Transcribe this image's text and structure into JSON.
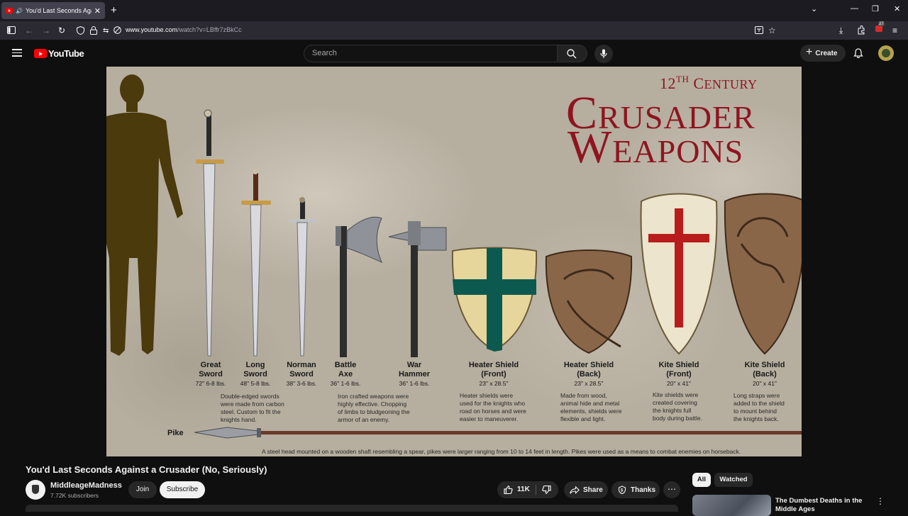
{
  "browser": {
    "tab_title": "You'd Last Seconds Against",
    "url_domain": "www.youtube.com",
    "url_path": "/watch?v=LBffr7zBkCc",
    "extension_badge": "27"
  },
  "youtube": {
    "logo_text": "YouTube",
    "search_placeholder": "Search",
    "create_label": "Create"
  },
  "video_frame": {
    "title_small": "12th Century",
    "title_line1": "Crusader",
    "title_line2": "Weapons",
    "weapons": [
      {
        "name1": "Great",
        "name2": "Sword",
        "dims": "72\" 6-8 lbs."
      },
      {
        "name1": "Long",
        "name2": "Sword",
        "dims": "48\" 5-8 lbs."
      },
      {
        "name1": "Norman",
        "name2": "Sword",
        "dims": "38\" 3-6 lbs."
      },
      {
        "name1": "Battle",
        "name2": "Axe",
        "dims": "36\" 1-6 lbs."
      },
      {
        "name1": "War",
        "name2": "Hammer",
        "dims": "36\" 1-6 lbs."
      },
      {
        "name1": "Heater Shield",
        "name2": "(Front)",
        "dims": "23\" x 28.5\""
      },
      {
        "name1": "Heater Shield",
        "name2": "(Back)",
        "dims": "23\" x 28.5\""
      },
      {
        "name1": "Kite Shield",
        "name2": "(Front)",
        "dims": "20\" x 41\""
      },
      {
        "name1": "Kite Shield",
        "name2": "(Back)",
        "dims": "20\" x 41\""
      }
    ],
    "descriptions": {
      "swords": [
        "Double-edged swords",
        "were made from carbon",
        "steel. Custom to fit the",
        "knights hand."
      ],
      "axes": [
        "Iron crafted weapons were",
        "highly effective. Chopping",
        "of limbs to bludgeoning the",
        "armor of an enemy."
      ],
      "heater_front": [
        "Heater shields were",
        "used for the knights who",
        "road on horses and were",
        "easier to maneuverer."
      ],
      "heater_back": [
        "Made from wood,",
        "animal hide and metal",
        "elements, shields were",
        "flexible and light."
      ],
      "kite_front": [
        "Kite shields were",
        "created covering",
        "the knights full",
        "body during battle."
      ],
      "kite_back": [
        "Long straps were",
        "added to the shield",
        "to mount behind",
        "the knights back."
      ]
    },
    "pike_label": "Pike",
    "pike_desc": "A steel head mounted on a wooden shaft resembling a spear, pikes were larger ranging from 10 to 14 feet in length. Pikes were used as a means to combat enemies on horseback."
  },
  "video_info": {
    "title": "You'd Last Seconds Against a Crusader (No, Seriously)",
    "channel_name": "MiddleageMadness",
    "subscribers": "7.72K subscribers",
    "join_label": "Join",
    "subscribe_label": "Subscribe",
    "like_count": "11K",
    "share_label": "Share",
    "thanks_label": "Thanks"
  },
  "sidebar": {
    "chips": [
      "All",
      "Watched"
    ],
    "rec_title": "The Dumbest Deaths in the Middle Ages"
  },
  "colors": {
    "title_red": "#8e1520",
    "youtube_red": "#ff0000",
    "cross_green": "#0c5a4f"
  }
}
